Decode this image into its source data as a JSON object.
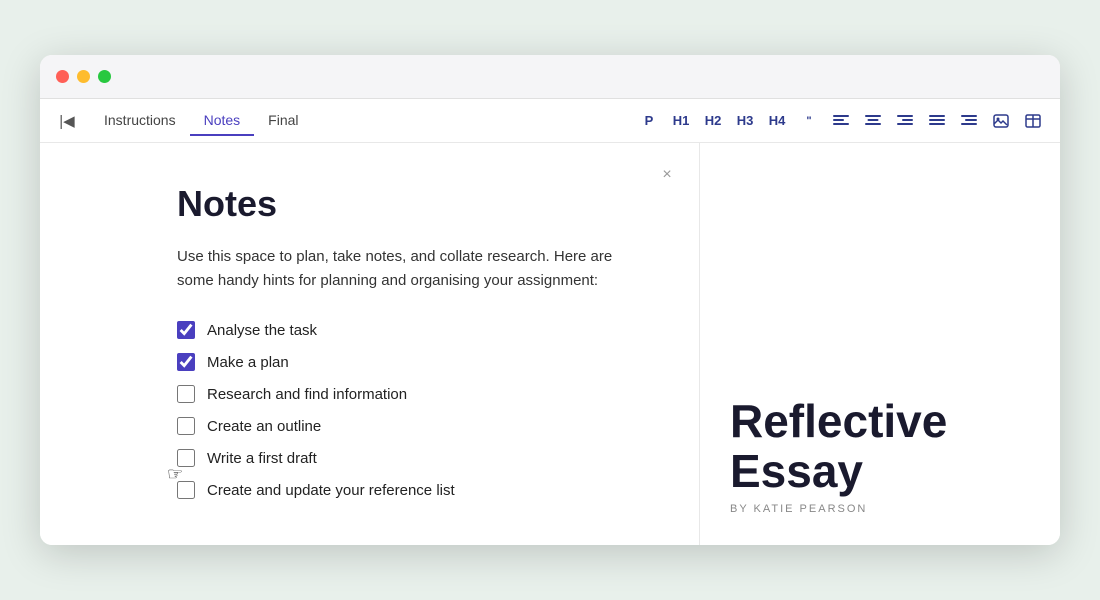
{
  "window": {
    "traffic_lights": [
      "red",
      "yellow",
      "green"
    ]
  },
  "toolbar": {
    "collapse_icon": "⊣",
    "tabs": [
      {
        "label": "Instructions",
        "active": false
      },
      {
        "label": "Notes",
        "active": true
      },
      {
        "label": "Final",
        "active": false
      }
    ],
    "format_buttons": [
      {
        "label": "P",
        "name": "paragraph"
      },
      {
        "label": "H1",
        "name": "heading1"
      },
      {
        "label": "H2",
        "name": "heading2"
      },
      {
        "label": "H3",
        "name": "heading3"
      },
      {
        "label": "H4",
        "name": "heading4"
      },
      {
        "label": "“”",
        "name": "blockquote"
      },
      {
        "label": "≡",
        "name": "align-left"
      },
      {
        "label": "≡",
        "name": "align-center"
      },
      {
        "label": "≡",
        "name": "align-right"
      },
      {
        "label": "≡",
        "name": "align-justify"
      },
      {
        "label": "≡",
        "name": "indent-decrease"
      },
      {
        "label": "📷",
        "name": "insert-image"
      },
      {
        "label": "⊞",
        "name": "insert-table"
      }
    ]
  },
  "notes": {
    "title": "Notes",
    "description": "Use this space to plan, take notes, and collate research. Here are some handy hints for planning and organising your assignment:",
    "close_label": "×",
    "checklist": [
      {
        "id": "item1",
        "text": "Analyse the task",
        "checked": true
      },
      {
        "id": "item2",
        "text": "Make a plan",
        "checked": true
      },
      {
        "id": "item3",
        "text": "Research and find information",
        "checked": false
      },
      {
        "id": "item4",
        "text": "Create an outline",
        "checked": false
      },
      {
        "id": "item5",
        "text": "Write a first draft",
        "checked": false
      },
      {
        "id": "item6",
        "text": "Create and update your reference list",
        "checked": false
      }
    ]
  },
  "right_panel": {
    "title": "Reflective Essay",
    "byline": "BY KATIE PEARSON"
  }
}
